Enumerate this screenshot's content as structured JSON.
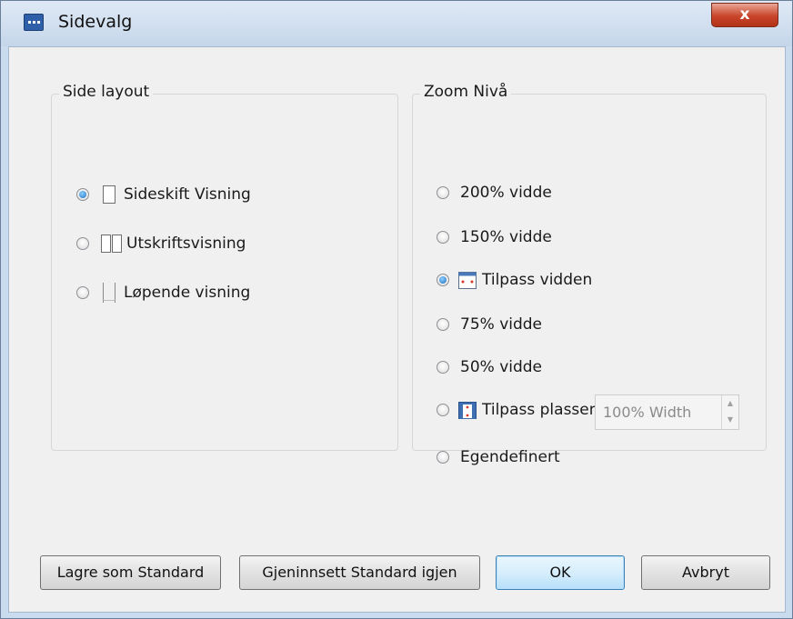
{
  "window": {
    "title": "Sidevalg",
    "close_glyph": "x",
    "icon": "app-window-icon"
  },
  "layout_group": {
    "label": "Side layout",
    "options": [
      {
        "label": "Sideskift Visning",
        "icon": "single-page-icon",
        "checked": true
      },
      {
        "label": "Utskriftsvisning",
        "icon": "two-page-icon",
        "checked": false
      },
      {
        "label": "Løpende visning",
        "icon": "continuous-page-icon",
        "checked": false
      }
    ]
  },
  "zoom_group": {
    "label": "Zoom Nivå",
    "options": [
      {
        "label": "200% vidde",
        "checked": false
      },
      {
        "label": "150% vidde",
        "checked": false
      },
      {
        "label": "Tilpass vidden",
        "icon": "fit-width-icon",
        "checked": true
      },
      {
        "label": "75% vidde",
        "checked": false
      },
      {
        "label": "50% vidde",
        "checked": false
      },
      {
        "label": "Tilpass plassen",
        "icon": "fit-page-icon",
        "checked": false
      },
      {
        "label": "Egendefinert",
        "checked": false
      }
    ],
    "custom_value": "100% Width"
  },
  "buttons": {
    "save_default": "Lagre som Standard",
    "restore_default": "Gjeninnsett Standard igjen",
    "ok": "OK",
    "cancel": "Avbryt"
  },
  "colors": {
    "accent": "#1a6fc0",
    "close": "#c8452a",
    "frame": "#c9dbee",
    "client": "#f0f0f0"
  }
}
